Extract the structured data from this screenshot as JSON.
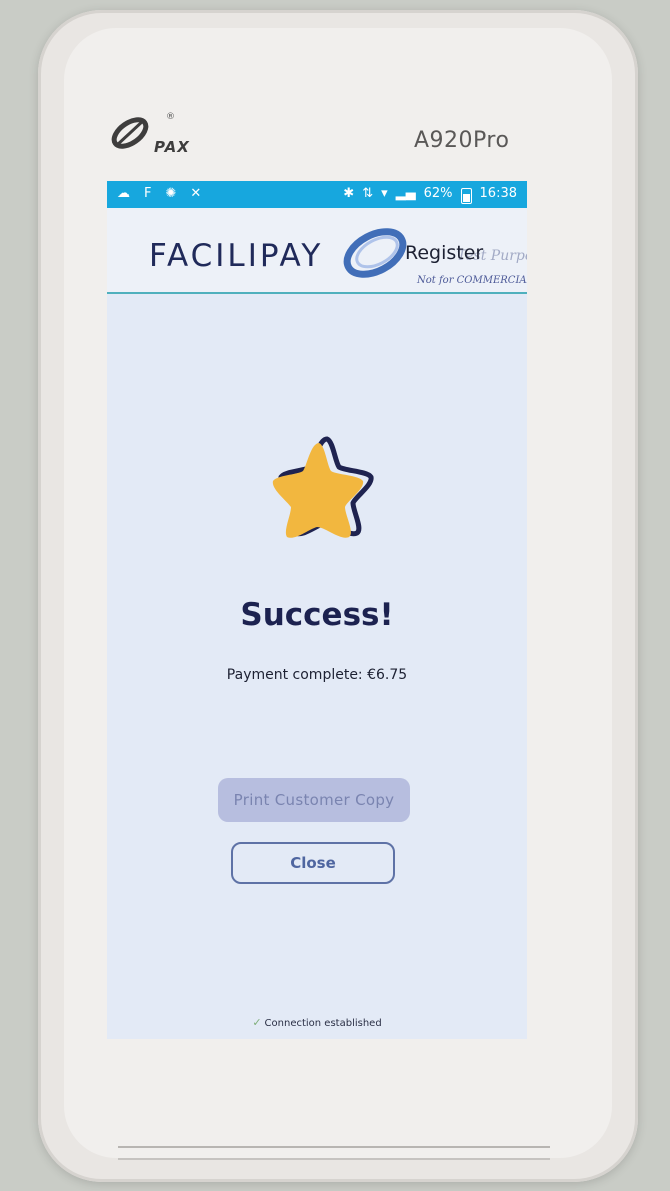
{
  "device": {
    "brand": "PAX",
    "registered_mark": "®",
    "model": "A920Pro"
  },
  "statusbar": {
    "left_icons": [
      "cloud-upload-icon",
      "f-icon",
      "loading-icon",
      "no-sim-icon"
    ],
    "left_glyphs": [
      "☁",
      "F",
      "✺",
      "✕"
    ],
    "bluetooth_glyph": "✱",
    "data_glyph": "⇅",
    "wifi_glyph": "▾",
    "signal_glyph": "▂▄",
    "battery_percent": "62%",
    "time": "16:38"
  },
  "header": {
    "logo_text": "FACILIPAY",
    "register_label": "Register",
    "watermark_line1": "Test Purposes only",
    "watermark_line2": "Not for COMMERCIAL USE"
  },
  "main": {
    "title": "Success!",
    "message": "Payment complete: €6.75",
    "print_button": "Print Customer Copy",
    "close_button": "Close"
  },
  "footer": {
    "check_glyph": "✓",
    "status": "Connection established"
  },
  "colors": {
    "statusbar": "#17a7de",
    "star": "#f2b73f",
    "title": "#1c2250",
    "print_button_bg": "#b7bedf",
    "close_border": "#5e72a6"
  }
}
